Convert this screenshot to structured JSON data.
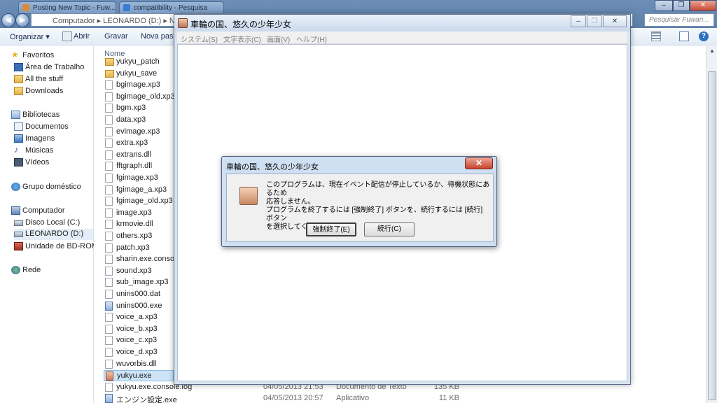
{
  "browser_tabs": [
    {
      "label": "Posting New Topic - Fuw...",
      "color": "#d98a3a"
    },
    {
      "label": "compatibility - Pesquisa",
      "color": "#3a7bd5"
    }
  ],
  "window_controls": {
    "minimize": "–",
    "restore": "❐",
    "close": "✕"
  },
  "explorer": {
    "breadcrumb": "Computador  ▸  LEONARDO (D:)  ▸  Na",
    "search_placeholder": "Pesquisar Fuwan...",
    "toolbar": {
      "organize": "Organizar ▾",
      "open": "Abrir",
      "burn": "Gravar",
      "new_folder": "Nova pasta"
    },
    "nav": {
      "favorites": "Favoritos",
      "desktop": "Área de Trabalho",
      "all_the_stuff": "All the stuff",
      "downloads": "Downloads",
      "libraries": "Bibliotecas",
      "documents": "Documentos",
      "images": "Imagens",
      "music": "Músicas",
      "videos": "Vídeos",
      "homegroup": "Grupo doméstico",
      "computer": "Computador",
      "disk_c": "Disco Local (C:)",
      "disk_d": "LEONARDO (D:)",
      "bd_rom": "Unidade de BD-ROM (F",
      "network": "Rede"
    },
    "column_name": "Nome",
    "files": [
      {
        "name": "yukyu_patch",
        "type": "folder"
      },
      {
        "name": "yukyu_save",
        "type": "folder"
      },
      {
        "name": "bgimage.xp3",
        "type": "file"
      },
      {
        "name": "bgimage_old.xp3",
        "type": "file"
      },
      {
        "name": "bgm.xp3",
        "type": "file"
      },
      {
        "name": "data.xp3",
        "type": "file"
      },
      {
        "name": "evimage.xp3",
        "type": "file"
      },
      {
        "name": "extra.xp3",
        "type": "file"
      },
      {
        "name": "extrans.dll",
        "type": "file"
      },
      {
        "name": "fftgraph.dll",
        "type": "file"
      },
      {
        "name": "fgimage.xp3",
        "type": "file"
      },
      {
        "name": "fgimage_a.xp3",
        "type": "file"
      },
      {
        "name": "fgimage_old.xp3",
        "type": "file"
      },
      {
        "name": "image.xp3",
        "type": "file"
      },
      {
        "name": "krmovie.dll",
        "type": "file"
      },
      {
        "name": "others.xp3",
        "type": "file"
      },
      {
        "name": "patch.xp3",
        "type": "file"
      },
      {
        "name": "sharin.exe.console.l",
        "type": "file"
      },
      {
        "name": "sound.xp3",
        "type": "file"
      },
      {
        "name": "sub_image.xp3",
        "type": "file"
      },
      {
        "name": "unins000.dat",
        "type": "file"
      },
      {
        "name": "unins000.exe",
        "type": "exe"
      },
      {
        "name": "voice_a.xp3",
        "type": "file"
      },
      {
        "name": "voice_b.xp3",
        "type": "file"
      },
      {
        "name": "voice_c.xp3",
        "type": "file"
      },
      {
        "name": "voice_d.xp3",
        "type": "file"
      },
      {
        "name": "wuvorbis.dll",
        "type": "file"
      },
      {
        "name": "yukyu.exe",
        "type": "app",
        "selected": true
      },
      {
        "name": "yukyu.exe.console.log",
        "type": "file",
        "date": "04/05/2013 21:53",
        "kind": "Documento de Texto",
        "size": "135 KB"
      },
      {
        "name": "エンジン設定.exe",
        "type": "exe",
        "date": "04/05/2013 20:57",
        "kind": "Aplicativo",
        "size": "11 KB"
      }
    ]
  },
  "game_window": {
    "title": "車輪の国、悠久の少年少女",
    "menu": [
      "システム(S)",
      "文字表示(C)",
      "画面(V)",
      "ヘルプ(H)"
    ]
  },
  "dialog": {
    "title": "車輪の国、悠久の少年少女",
    "close": "✕",
    "message_lines": [
      "このプログラムは、現在イベント配信が停止しているか、待機状態にあるため",
      "応答しません。",
      "プログラムを終了するには [強制終了] ボタンを、続行するには [続行] ボタン",
      "を選択してください。"
    ],
    "force_quit": "強制終了(E)",
    "continue": "続行(C)"
  }
}
